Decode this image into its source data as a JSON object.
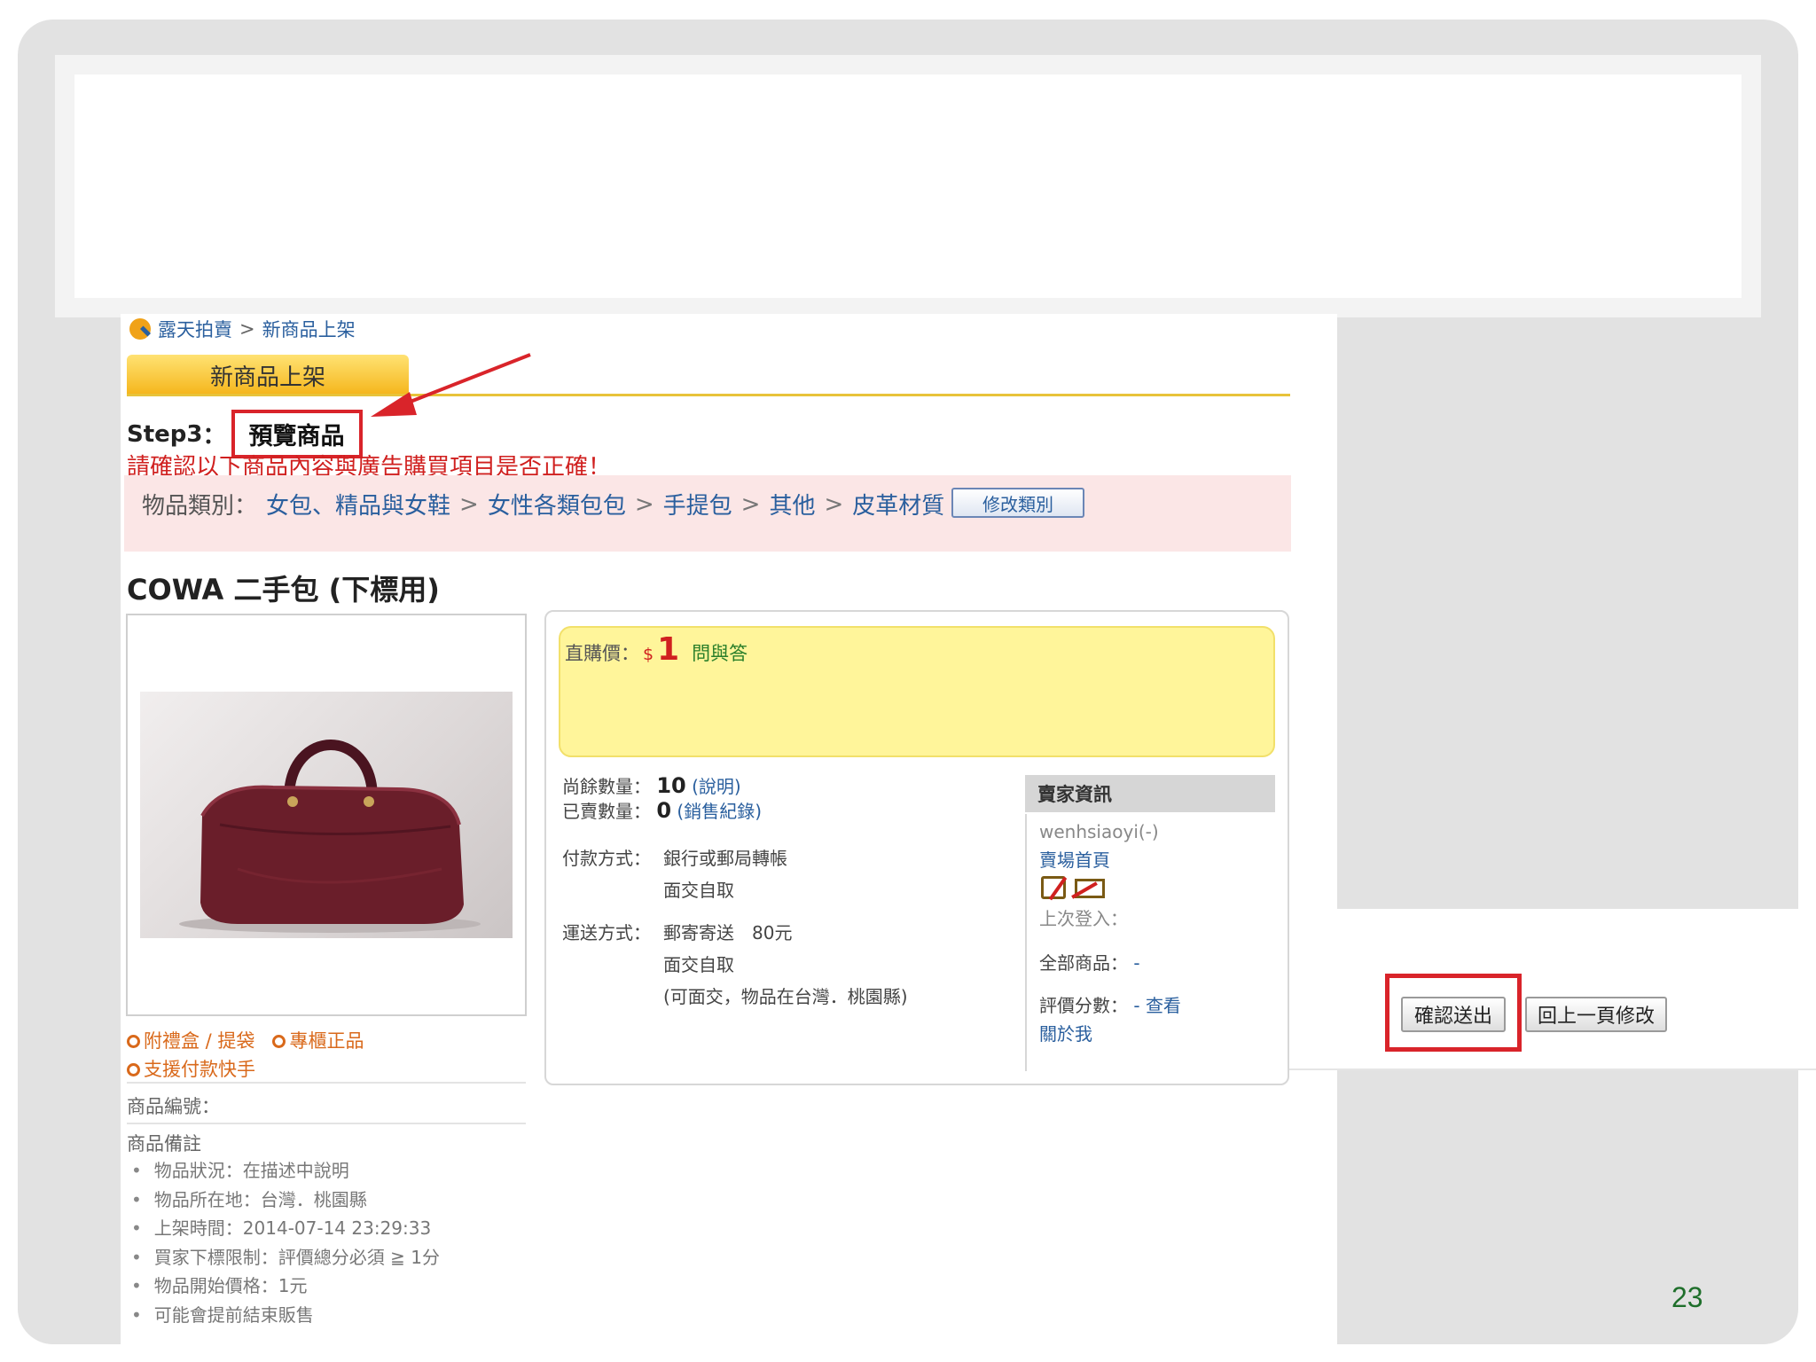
{
  "slide": {
    "page_number": "23"
  },
  "breadcrumb": {
    "home": "露天拍賣",
    "separator": ">",
    "current": "新商品上架"
  },
  "tab": {
    "label": "新商品上架"
  },
  "step": {
    "prefix": "Step3",
    "colon": "：",
    "title": "預覽商品"
  },
  "warning": "請確認以下商品內容與廣告購買項目是否正確！",
  "category": {
    "label": "物品類別：",
    "path": [
      "女包、精品與女鞋",
      "女性各類包包",
      "手提包",
      "其他",
      "皮革材質"
    ],
    "separator": ">",
    "edit_button": "修改類別"
  },
  "product": {
    "title": "COWA 二手包 (下標用)",
    "tags": [
      "附禮盒 / 提袋",
      "專櫃正品",
      "支援付款快手"
    ],
    "id_label": "商品編號：",
    "notes_title": "商品備註",
    "notes": [
      "物品狀況：在描述中說明",
      "物品所在地：台灣．桃園縣",
      "上架時間：2014-07-14 23:29:33",
      "買家下標限制：評價總分必須 ≧ 1分",
      "物品開始價格：1元",
      "可能會提前結束販售"
    ]
  },
  "price": {
    "label": "直購價：",
    "currency": "$",
    "value": "1",
    "qa_link": "問與答"
  },
  "stock": {
    "remaining_label": "尚餘數量：",
    "remaining": "10",
    "remaining_link": "(說明)",
    "sold_label": "已賣數量：",
    "sold": "0",
    "sold_link": "(銷售紀錄)"
  },
  "payment": {
    "label": "付款方式：",
    "options": [
      "銀行或郵局轉帳",
      "面交自取"
    ]
  },
  "shipping": {
    "label": "運送方式：",
    "options": [
      "郵寄寄送　80元",
      "面交自取",
      "(可面交，物品在台灣．桃園縣)"
    ]
  },
  "seller": {
    "header": "賣家資訊",
    "name": "wenhsiaoyi(-)",
    "store_link": "賣場首頁",
    "last_login_label": "上次登入：",
    "all_items_label": "全部商品：",
    "all_items_value": "-",
    "rating_label": "評價分數：",
    "rating_value": "-",
    "rating_link": "查看",
    "about_link": "關於我"
  },
  "actions": {
    "confirm": "確認送出",
    "back": "回上一頁修改"
  },
  "colors": {
    "accent_red": "#d9242a",
    "link_blue": "#2a5f9e",
    "tab_gold": "#f5b51a",
    "price_bg": "#fff59a"
  }
}
